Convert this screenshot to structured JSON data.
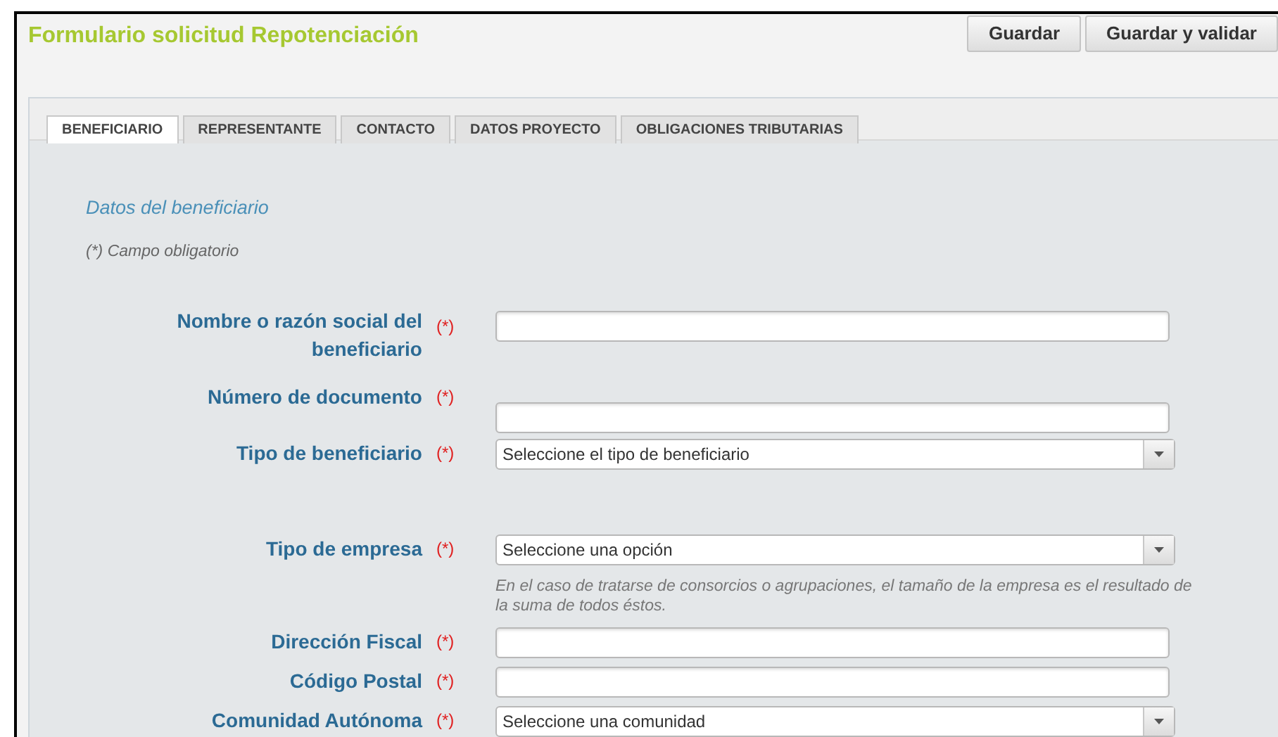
{
  "header": {
    "title": "Formulario solicitud Repotenciación",
    "buttons": [
      "Guardar",
      "Guardar y validar"
    ]
  },
  "tabs": [
    {
      "label": "BENEFICIARIO",
      "selected": true
    },
    {
      "label": "REPRESENTANTE",
      "selected": false
    },
    {
      "label": "CONTACTO",
      "selected": false
    },
    {
      "label": "DATOS PROYECTO",
      "selected": false
    },
    {
      "label": "OBLIGACIONES TRIBUTARIAS",
      "selected": false
    }
  ],
  "section": {
    "title": "Datos del beneficiario",
    "required_note": "(*) Campo obligatorio"
  },
  "fields": [
    {
      "label": "Nombre o razón social del beneficiario",
      "required": "(*)",
      "kind": "text"
    },
    {
      "label": "Número de documento",
      "required": "(*)",
      "kind": "text"
    },
    {
      "label": "Tipo de beneficiario",
      "required": "(*)",
      "kind": "select",
      "value": "Seleccione el tipo de beneficiario"
    },
    {
      "label": "Tipo de empresa",
      "required": "(*)",
      "kind": "select",
      "value": "Seleccione una opción",
      "note": "En el caso de tratarse de consorcios o agrupaciones, el tamaño de la empresa es el resultado de la suma de todos éstos."
    },
    {
      "label": "Dirección Fiscal",
      "required": "(*)",
      "kind": "text"
    },
    {
      "label": "Código Postal",
      "required": "(*)",
      "kind": "text"
    },
    {
      "label": "Comunidad Autónoma",
      "required": "(*)",
      "kind": "select",
      "value": "Seleccione una comunidad"
    }
  ]
}
